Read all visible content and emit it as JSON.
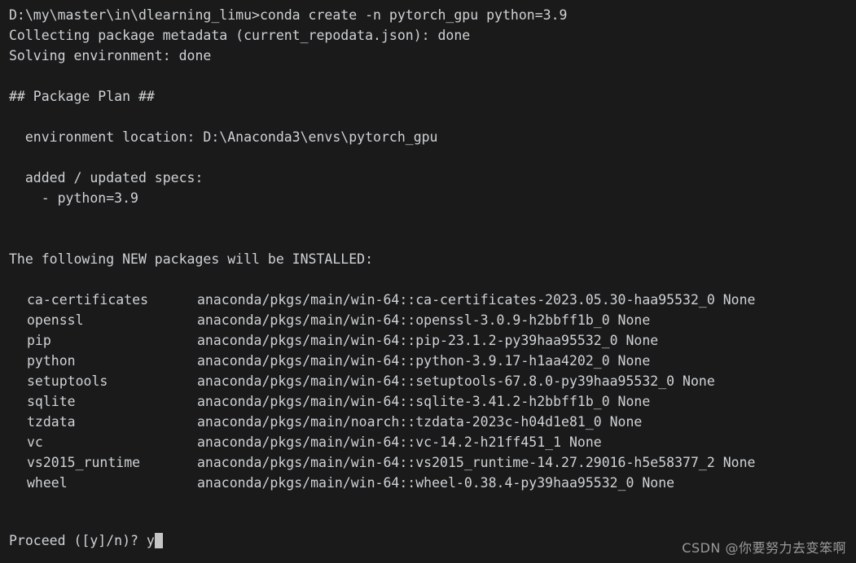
{
  "terminal": {
    "background_color": "#1a1a1a",
    "text_color": "#cfd2d6",
    "cursor_color": "#c6c6c6",
    "lines": [
      "D:\\my\\master\\in\\dlearning_limu>conda create -n pytorch_gpu python=3.9",
      "Collecting package metadata (current_repodata.json): done",
      "Solving environment: done",
      "",
      "## Package Plan ##",
      "",
      "  environment location: D:\\Anaconda3\\envs\\pytorch_gpu",
      "",
      "  added / updated specs:",
      "    - python=3.9",
      "",
      "",
      "The following NEW packages will be INSTALLED:",
      ""
    ],
    "command": "conda create -n pytorch_gpu python=3.9",
    "prompt_path": "D:\\my\\master\\in\\dlearning_limu>",
    "environment_location": "D:\\Anaconda3\\envs\\pytorch_gpu",
    "added_spec": "python=3.9",
    "packages_header": "The following NEW packages will be INSTALLED:",
    "packages": [
      {
        "name": "ca-certificates",
        "spec": "anaconda/pkgs/main/win-64::ca-certificates-2023.05.30-haa95532_0 None"
      },
      {
        "name": "openssl",
        "spec": "anaconda/pkgs/main/win-64::openssl-3.0.9-h2bbff1b_0 None"
      },
      {
        "name": "pip",
        "spec": "anaconda/pkgs/main/win-64::pip-23.1.2-py39haa95532_0 None"
      },
      {
        "name": "python",
        "spec": "anaconda/pkgs/main/win-64::python-3.9.17-h1aa4202_0 None"
      },
      {
        "name": "setuptools",
        "spec": "anaconda/pkgs/main/win-64::setuptools-67.8.0-py39haa95532_0 None"
      },
      {
        "name": "sqlite",
        "spec": "anaconda/pkgs/main/win-64::sqlite-3.41.2-h2bbff1b_0 None"
      },
      {
        "name": "tzdata",
        "spec": "anaconda/pkgs/main/noarch::tzdata-2023c-h04d1e81_0 None"
      },
      {
        "name": "vc",
        "spec": "anaconda/pkgs/main/win-64::vc-14.2-h21ff451_1 None"
      },
      {
        "name": "vs2015_runtime",
        "spec": "anaconda/pkgs/main/win-64::vs2015_runtime-14.27.29016-h5e58377_2 None"
      },
      {
        "name": "wheel",
        "spec": "anaconda/pkgs/main/win-64::wheel-0.38.4-py39haa95532_0 None"
      }
    ],
    "proceed_prompt": "Proceed ([y]/n)? ",
    "typed_answer": "y"
  },
  "watermark": {
    "text": "CSDN @你要努力去变笨啊"
  }
}
